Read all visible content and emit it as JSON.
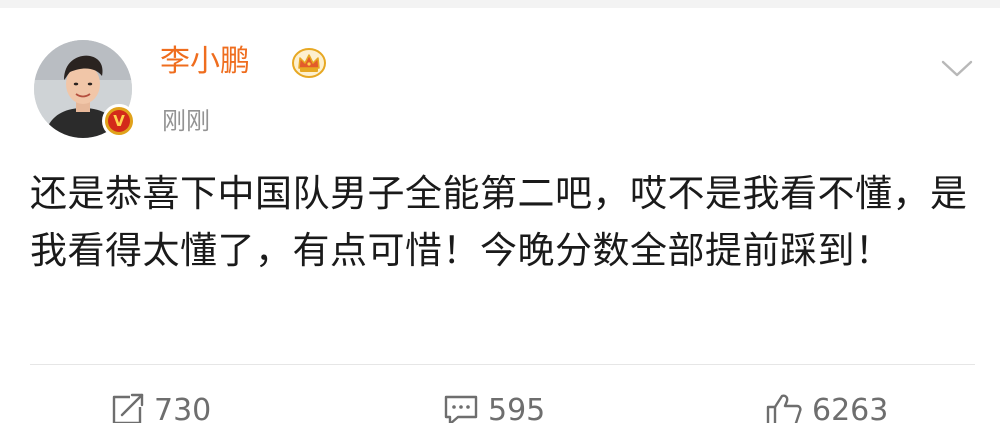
{
  "post": {
    "user": {
      "name": "李小鹏",
      "verified_badge": "V",
      "avatar_icon": "user-avatar",
      "crown_icon": "crown-icon",
      "colors": {
        "name": "#ef6d1e",
        "badge_outer": "#e0a21b",
        "badge_inner": "#d32a1a"
      }
    },
    "timestamp": "刚刚",
    "menu_icon": "chevron-down-icon",
    "content": "还是恭喜下中国队男子全能第二吧，哎不是我看不懂，是我看得太懂了，有点可惜！今晚分数全部提前踩到！",
    "actions": {
      "repost": {
        "icon": "repost-icon",
        "count": "730"
      },
      "comment": {
        "icon": "comment-icon",
        "count": "595"
      },
      "like": {
        "icon": "like-icon",
        "count": "6263"
      }
    }
  }
}
